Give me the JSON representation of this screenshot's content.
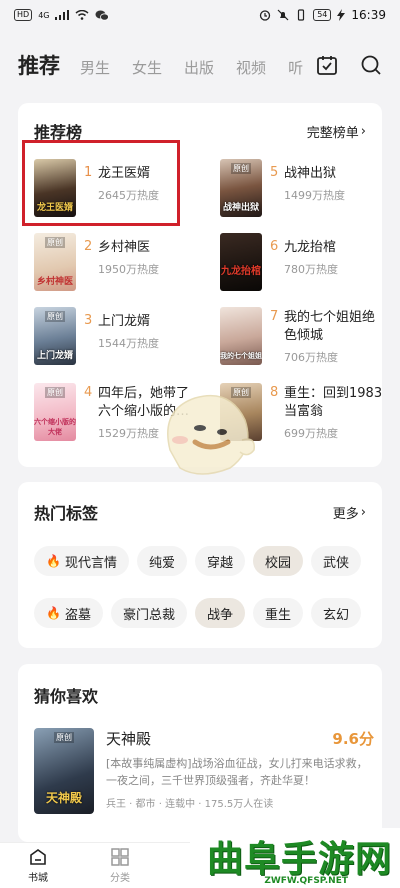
{
  "status_bar": {
    "left_badges": [
      "HD",
      "4G"
    ],
    "battery": "54",
    "time": "16:39"
  },
  "nav": {
    "tabs": [
      {
        "label": "推荐",
        "active": true
      },
      {
        "label": "男生"
      },
      {
        "label": "女生"
      },
      {
        "label": "出版"
      },
      {
        "label": "视频"
      },
      {
        "label": "听"
      }
    ],
    "icons": [
      "calendar-check-icon",
      "search-icon"
    ]
  },
  "ranking": {
    "title": "推荐榜",
    "more": "完整榜单",
    "items": [
      {
        "rank": "1",
        "name": "龙王医婿",
        "heat": "2645万热度",
        "cover_caption": "龙王医婿",
        "cover_tag": ""
      },
      {
        "rank": "2",
        "name": "乡村神医",
        "heat": "1950万热度",
        "cover_caption": "乡村神医",
        "cover_tag": "原创"
      },
      {
        "rank": "3",
        "name": "上门龙婿",
        "heat": "1544万热度",
        "cover_caption": "上门龙婿",
        "cover_tag": "原创"
      },
      {
        "rank": "4",
        "name": "四年后，她带了六个缩小版的…",
        "heat": "1529万热度",
        "cover_caption": "六个缩小版的大佬",
        "cover_tag": "原创"
      },
      {
        "rank": "5",
        "name": "战神出狱",
        "heat": "1499万热度",
        "cover_caption": "战神出狱",
        "cover_tag": "原创"
      },
      {
        "rank": "6",
        "name": "九龙抬棺",
        "heat": "780万热度",
        "cover_caption": "九龙抬棺",
        "cover_tag": ""
      },
      {
        "rank": "7",
        "name": "我的七个姐姐绝色倾城",
        "heat": "706万热度",
        "cover_caption": "我的七个姐姐",
        "cover_tag": ""
      },
      {
        "rank": "8",
        "name": "重生：回到1983当富翁",
        "heat": "699万热度",
        "cover_caption": "",
        "cover_tag": "原创"
      }
    ]
  },
  "tags": {
    "title": "热门标签",
    "more": "更多",
    "row1": [
      {
        "label": "现代言情",
        "hot": true
      },
      {
        "label": "纯爱"
      },
      {
        "label": "穿越"
      },
      {
        "label": "校园",
        "alt": true
      },
      {
        "label": "武侠"
      }
    ],
    "row2": [
      {
        "label": "盗墓",
        "hot": true
      },
      {
        "label": "豪门总裁"
      },
      {
        "label": "战争",
        "alt": true
      },
      {
        "label": "重生"
      },
      {
        "label": "玄幻"
      }
    ]
  },
  "guess": {
    "title": "猜你喜欢",
    "book": {
      "name": "天神殿",
      "score": "9.6分",
      "desc": "[本故事纯属虚构]战场浴血征战，女儿打来电话求救，一夜之间，三千世界顶级强者，齐赴华夏！",
      "meta": "兵王 · 都市 · 连载中 · 175.5万人在读",
      "cover_caption": "天神殿",
      "cover_tag": "原创"
    }
  },
  "bottom_nav": [
    {
      "label": "书城",
      "active": true
    },
    {
      "label": "分类"
    }
  ],
  "watermark": {
    "text": "曲阜手游网",
    "url": "ZWFW.QFSP.NET"
  }
}
